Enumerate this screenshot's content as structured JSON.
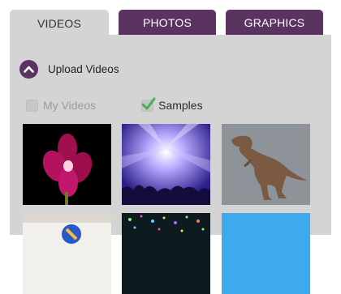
{
  "tabs": [
    {
      "label": "VIDEOS",
      "active": true
    },
    {
      "label": "PHOTOS",
      "active": false
    },
    {
      "label": "GRAPHICS",
      "active": false
    }
  ],
  "upload": {
    "label": "Upload Videos",
    "icon": "chevron-up-icon"
  },
  "filters": [
    {
      "label": "My Videos",
      "checked": false,
      "enabled": false
    },
    {
      "label": "Samples",
      "checked": true,
      "enabled": true
    }
  ],
  "thumbnails": [
    {
      "subject": "pink orchid flower on black"
    },
    {
      "subject": "concert crowd with purple stage lights"
    },
    {
      "subject": "dinosaur on grey background"
    },
    {
      "subject": "person in white shirt with ball graphic"
    },
    {
      "subject": "colorful light particles"
    },
    {
      "subject": "blue background"
    }
  ],
  "colors": {
    "accent": "#5a3361",
    "panel": "#d4d4d4",
    "check": "#4caf50"
  }
}
